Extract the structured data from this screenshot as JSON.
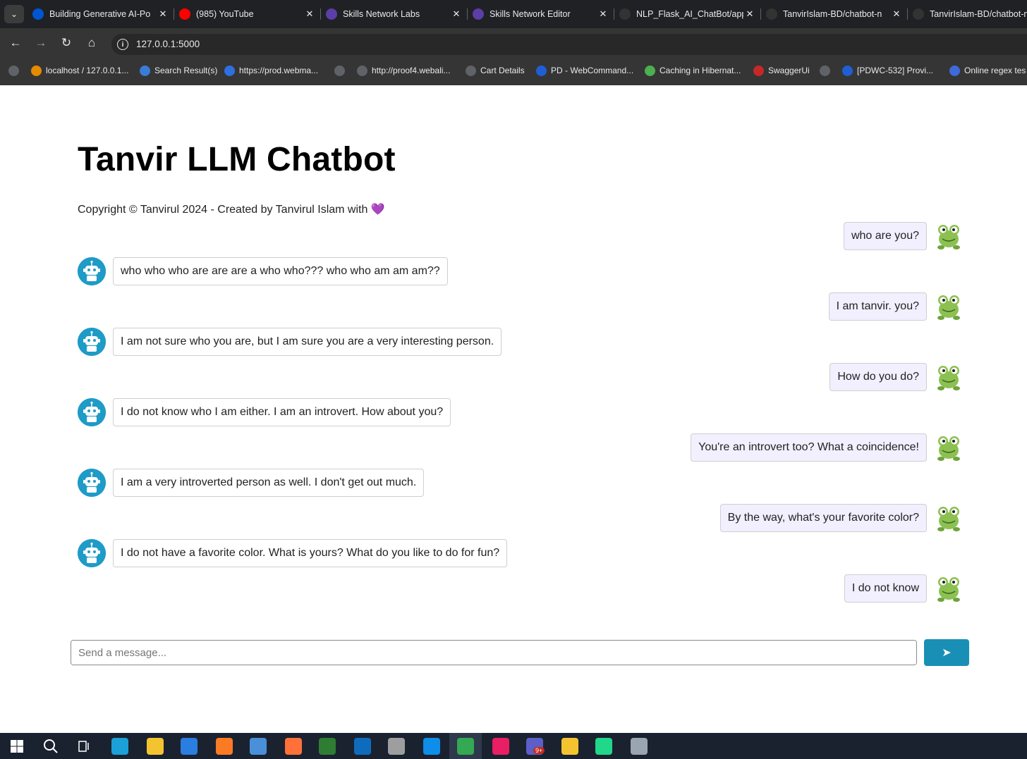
{
  "browser": {
    "tabs": [
      {
        "title": "Building Generative AI-Po",
        "icon": "coursera-icon",
        "color": "#0056d2"
      },
      {
        "title": "(985) YouTube",
        "icon": "youtube-icon",
        "color": "#ff0000"
      },
      {
        "title": "Skills Network Labs",
        "icon": "skills-network-icon",
        "color": "#5b3ea8"
      },
      {
        "title": "Skills Network Editor",
        "icon": "skills-network-icon",
        "color": "#5b3ea8"
      },
      {
        "title": "NLP_Flask_AI_ChatBot/app",
        "icon": "github-icon",
        "color": "#333333"
      },
      {
        "title": "TanvirIslam-BD/chatbot-n",
        "icon": "github-icon",
        "color": "#333333"
      },
      {
        "title": "TanvirIslam-BD/chatbot-n",
        "icon": "github-icon",
        "color": "#333333"
      }
    ],
    "url": "127.0.0.1:5000",
    "bookmarks": [
      {
        "label": "",
        "icon": "globe-icon",
        "color": "#5f6368"
      },
      {
        "label": "localhost / 127.0.0.1...",
        "icon": "phpmyadmin-icon",
        "color": "#e68a00"
      },
      {
        "label": "Search Result(s)",
        "icon": "search-result-icon",
        "color": "#3a7bd5"
      },
      {
        "label": "https://prod.webma...",
        "icon": "diamond-icon",
        "color": "#2f6fe0"
      },
      {
        "label": "",
        "icon": "globe-icon",
        "color": "#5f6368"
      },
      {
        "label": "http://proof4.webali...",
        "icon": "globe-icon",
        "color": "#5f6368"
      },
      {
        "label": "Cart Details",
        "icon": "globe-icon",
        "color": "#5f6368"
      },
      {
        "label": "PD - WebCommand...",
        "icon": "jira-icon",
        "color": "#1f5fd6"
      },
      {
        "label": "Caching in Hibernat...",
        "icon": "leaf-icon",
        "color": "#4caf50"
      },
      {
        "label": "SwaggerUi",
        "icon": "swagger-icon",
        "color": "#c62828"
      },
      {
        "label": "",
        "icon": "globe-icon",
        "color": "#5f6368"
      },
      {
        "label": "[PDWC-532] Provi...",
        "icon": "jira-icon",
        "color": "#1f5fd6"
      },
      {
        "label": "Online regex tes",
        "icon": "regex-icon",
        "color": "#3d6bd8"
      }
    ]
  },
  "page": {
    "title": "Tanvir LLM Chatbot",
    "copyright": "Copyright © Tanvirul 2024 - Created by Tanvirul Islam with",
    "heart": "💜"
  },
  "messages": [
    {
      "role": "user",
      "text": "who are you?"
    },
    {
      "role": "bot",
      "text": "who who who are are are a who who??? who who am am am??"
    },
    {
      "role": "user",
      "text": "I am tanvir. you?"
    },
    {
      "role": "bot",
      "text": "I am not sure who you are, but I am sure you are a very interesting person."
    },
    {
      "role": "user",
      "text": "How do you do?"
    },
    {
      "role": "bot",
      "text": "I do not know who I am either. I am an introvert. How about you?"
    },
    {
      "role": "user",
      "text": "You're an introvert too? What a coincidence!"
    },
    {
      "role": "bot",
      "text": "I am a very introverted person as well. I don't get out much."
    },
    {
      "role": "user",
      "text": "By the way, what's your favorite color?"
    },
    {
      "role": "bot",
      "text": "I do not have a favorite color. What is yours? What do you like to do for fun?"
    },
    {
      "role": "user",
      "text": "I do not know"
    }
  ],
  "composer": {
    "placeholder": "Send a message...",
    "value": "",
    "send_label": "➤"
  },
  "taskbar": [
    {
      "icon": "windows-start-icon",
      "color": "#1a2230"
    },
    {
      "icon": "search-icon",
      "color": "#1a2230"
    },
    {
      "icon": "task-view-icon",
      "color": "#1a2230"
    },
    {
      "icon": "edge-icon",
      "color": "#1ba0d8"
    },
    {
      "icon": "file-explorer-icon",
      "color": "#f4c430"
    },
    {
      "icon": "microsoft-store-icon",
      "color": "#2a7de1"
    },
    {
      "icon": "xampp-icon",
      "color": "#fb7a24"
    },
    {
      "icon": "remote-desktop-icon",
      "color": "#4a90d9"
    },
    {
      "icon": "firefox-icon",
      "color": "#ff7139"
    },
    {
      "icon": "heidisql-icon",
      "color": "#2e7d32"
    },
    {
      "icon": "outlook-icon",
      "color": "#0f6cbd"
    },
    {
      "icon": "app-icon",
      "color": "#9e9e9e"
    },
    {
      "icon": "teamviewer-icon",
      "color": "#0e8ee9"
    },
    {
      "icon": "chrome-icon",
      "color": "#34a853"
    },
    {
      "icon": "intellij-icon",
      "color": "#e91e63"
    },
    {
      "icon": "teams-icon",
      "color": "#5b5fc7"
    },
    {
      "icon": "git-icon",
      "color": "#f4c430"
    },
    {
      "icon": "pycharm-icon",
      "color": "#21d789"
    },
    {
      "icon": "monitor-icon",
      "color": "#9aa5b1"
    }
  ],
  "taskbar_badge": "9+"
}
